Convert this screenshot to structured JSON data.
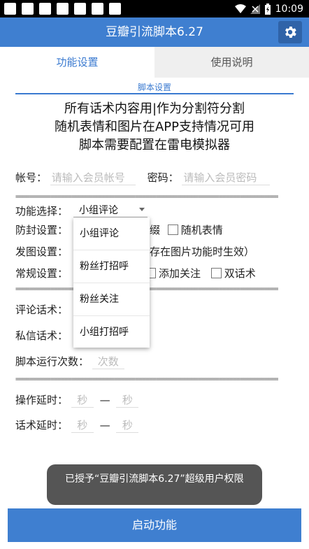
{
  "status_bar": {
    "time": "10:09"
  },
  "app": {
    "title": "豆瓣引流脚本6.27",
    "settings_icon": "gear-icon"
  },
  "tabs": [
    {
      "label": "功能设置",
      "active": true
    },
    {
      "label": "使用说明",
      "active": false
    }
  ],
  "section": {
    "caption": "脚本设置"
  },
  "info_lines": [
    "所有话术内容用|作为分割符分割",
    "随机表情和图片在APP支持情况可用",
    "脚本需要配置在雷电模拟器"
  ],
  "account": {
    "label": "帐号：",
    "placeholder": "请输入会员帐号",
    "password_label": "密码：",
    "password_placeholder": "请输入会员密码"
  },
  "separator_text": "====================================================================================",
  "function_select": {
    "label": "功能选择：",
    "selected": "小组评论"
  },
  "anti_block": {
    "label": "防封设置：",
    "suffix_text": "缀",
    "random_emoji_label": "随机表情"
  },
  "image_setting": {
    "label": "发图设置：",
    "note": "存在图片功能时生效）"
  },
  "general_setting": {
    "label": "常规设置：",
    "add_follow_label": "添加关注",
    "dual_script_label": "双话术"
  },
  "comment_script": {
    "label": "评论话术："
  },
  "dm_script": {
    "label": "私信话术："
  },
  "run_count": {
    "label": "脚本运行次数：",
    "placeholder": "次数"
  },
  "op_delay": {
    "label": "操作延时：",
    "from_placeholder": "秒",
    "dash": "—",
    "to_placeholder": "秒"
  },
  "script_delay": {
    "label": "话术延时：",
    "from_placeholder": "秒",
    "dash": "—",
    "to_placeholder": "秒"
  },
  "dropdown": {
    "options": [
      "小组评论",
      "粉丝打招呼",
      "粉丝关注",
      "小组打招呼"
    ]
  },
  "toast": {
    "text": "已授予“豆瓣引流脚本6.27”超级用户权限"
  },
  "start_button": {
    "label": "启动功能"
  },
  "colors": {
    "primary": "#3f7fd0",
    "accent_text": "#3a7ad0",
    "toast_bg": "#555555"
  }
}
